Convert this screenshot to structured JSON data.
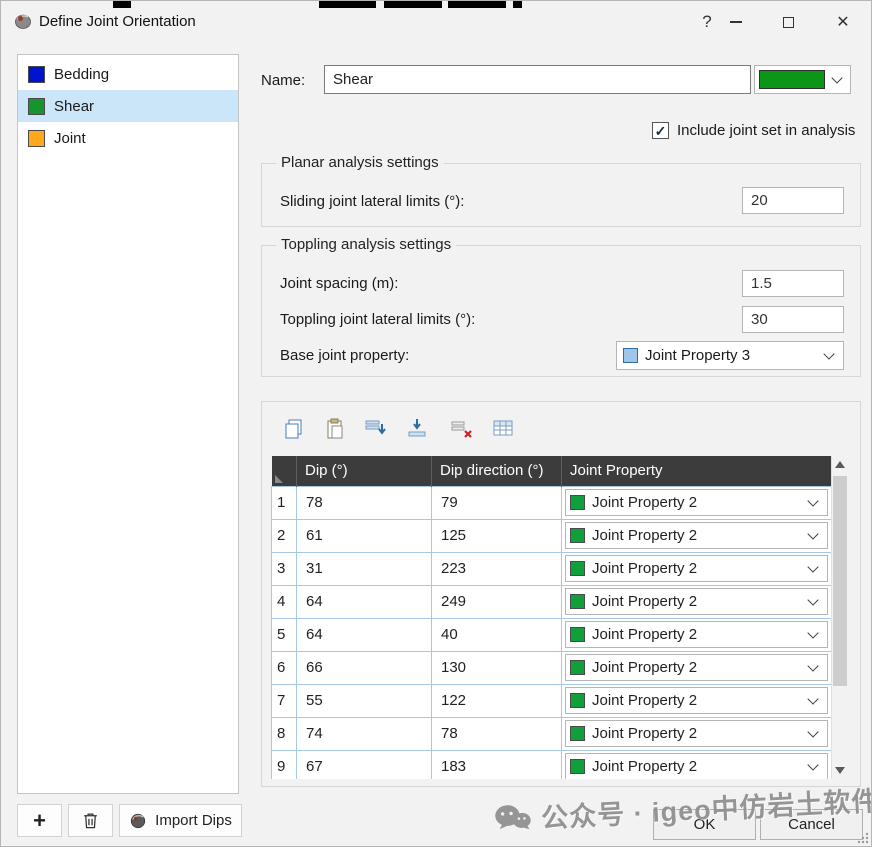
{
  "window": {
    "title": "Define Joint Orientation"
  },
  "icons": {
    "check": "✓",
    "help": "?",
    "close": "✕"
  },
  "sidebar": {
    "items": [
      {
        "label": "Bedding",
        "color": "#0013cf",
        "selected": false
      },
      {
        "label": "Shear",
        "color": "#18942f",
        "selected": true
      },
      {
        "label": "Joint",
        "color": "#ffa81f",
        "selected": false
      }
    ]
  },
  "left_toolbar": {
    "add": "+",
    "import": "Import Dips"
  },
  "form": {
    "name_label": "Name:",
    "name_value": "Shear",
    "name_color": "#0c9618",
    "include_label": "Include joint set in analysis",
    "include_checked": true,
    "planar": {
      "title": "Planar analysis settings",
      "sliding_label": "Sliding joint lateral limits (°):",
      "sliding_value": "20"
    },
    "toppling": {
      "title": "Toppling analysis settings",
      "spacing_label": "Joint spacing (m):",
      "spacing_value": "1.5",
      "lateral_label": "Toppling joint lateral limits (°):",
      "lateral_value": "30",
      "base_label": "Base joint property:",
      "base_value": "Joint Property 3",
      "base_color": "#9fc5e8"
    }
  },
  "table": {
    "columns": [
      "Dip (°)",
      "Dip direction (°)",
      "Joint Property"
    ],
    "prop_color": "#0fa03c",
    "rows": [
      {
        "n": "1",
        "dip": "78",
        "dir": "79",
        "prop": "Joint Property 2"
      },
      {
        "n": "2",
        "dip": "61",
        "dir": "125",
        "prop": "Joint Property 2"
      },
      {
        "n": "3",
        "dip": "31",
        "dir": "223",
        "prop": "Joint Property 2"
      },
      {
        "n": "4",
        "dip": "64",
        "dir": "249",
        "prop": "Joint Property 2"
      },
      {
        "n": "5",
        "dip": "64",
        "dir": "40",
        "prop": "Joint Property 2"
      },
      {
        "n": "6",
        "dip": "66",
        "dir": "130",
        "prop": "Joint Property 2"
      },
      {
        "n": "7",
        "dip": "55",
        "dir": "122",
        "prop": "Joint Property 2"
      },
      {
        "n": "8",
        "dip": "74",
        "dir": "78",
        "prop": "Joint Property 2"
      },
      {
        "n": "9",
        "dip": "67",
        "dir": "183",
        "prop": "Joint Property 2"
      }
    ]
  },
  "buttons": {
    "ok": "OK",
    "cancel": "Cancel"
  },
  "watermark": {
    "text": "公众号 · igeo中仿岩土软件"
  }
}
